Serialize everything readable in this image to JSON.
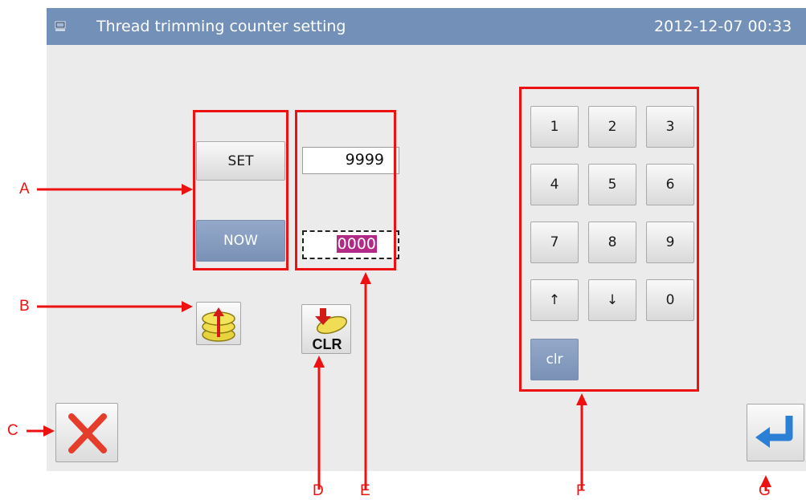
{
  "titlebar": {
    "title": "Thread trimming counter setting",
    "datetime": "2012-12-07  00:33",
    "icon": "monitor-icon"
  },
  "counter": {
    "set_label": "SET",
    "set_value": "9999",
    "now_label": "NOW",
    "now_value": "0000"
  },
  "actions": {
    "stack_icon": "stack-up-arrow-icon",
    "clr_label": "CLR",
    "clr_icon": "clr-bobbin-arrow-icon",
    "cancel_icon": "red-x-icon",
    "enter_icon": "enter-return-icon"
  },
  "keypad": {
    "keys": [
      "1",
      "2",
      "3",
      "4",
      "5",
      "6",
      "7",
      "8",
      "9",
      "↑",
      "↓",
      "0"
    ],
    "clear_label": "clr"
  },
  "callouts": {
    "A": "A",
    "B": "B",
    "C": "C",
    "D": "D",
    "E": "E",
    "F": "F",
    "G": "G"
  },
  "colors": {
    "titlebar": "#7390b8",
    "callout_red": "#ee1111",
    "active_value_bg": "#b22a86",
    "background": "#ebebeb"
  }
}
